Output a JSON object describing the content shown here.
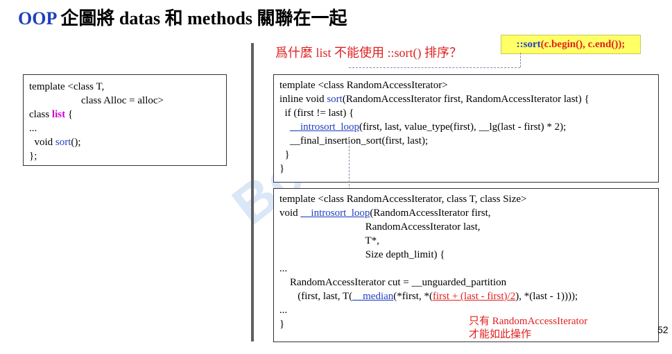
{
  "title": {
    "oop": "OOP",
    "rest": " 企圖將 datas 和 methods 關聯在一起"
  },
  "question": "爲什麼 list 不能使用 ::sort() 排序？",
  "callout": {
    "prefix": "::",
    "func": "sort",
    "args": "(c.begin(), c.end());"
  },
  "list_box": {
    "line1": "template <class T,",
    "line2": "                    class Alloc = alloc>",
    "line3_a": "class ",
    "line3_kw": "list",
    "line3_b": " {",
    "line4": "...",
    "line5_a": "  void ",
    "line5_fn": "sort",
    "line5_b": "();",
    "line6": "};"
  },
  "sort_box": {
    "line1": "template <class RandomAccessIterator>",
    "line2_a": "inline void ",
    "line2_fn": "sort",
    "line2_b": "(RandomAccessIterator first, RandomAccessIterator last) {",
    "line3": "  if (first != last) {",
    "line4_indent": "    ",
    "line4_fn": "__introsort_loop",
    "line4_b": "(first, last, value_type(first), __lg(last - first) * 2);",
    "line5": "    __final_insertion_sort(first, last);",
    "line6": "  }",
    "line7": "}"
  },
  "loop_box": {
    "line1": "template <class RandomAccessIterator, class T, class Size>",
    "line2_a": "void ",
    "line2_fn": "__introsort_loop",
    "line2_b": "(RandomAccessIterator first,",
    "line3": "                                 RandomAccessIterator last,",
    "line4": "                                 T*,",
    "line5": "                                 Size depth_limit) {",
    "line6": "...",
    "line7": "    RandomAccessIterator cut = __unguarded_partition",
    "line8_a": "       (first, last, T(",
    "line8_fn": "__median",
    "line8_b": "(*first, *(",
    "line8_red": "first + (last - first)/2",
    "line8_c": "), *(last - 1))));",
    "line9": "...",
    "line10": "}"
  },
  "note": {
    "line1": "只有 RandomAccessIterator",
    "line2": "才能如此操作"
  },
  "page_number": "52",
  "watermark": "Boolan"
}
